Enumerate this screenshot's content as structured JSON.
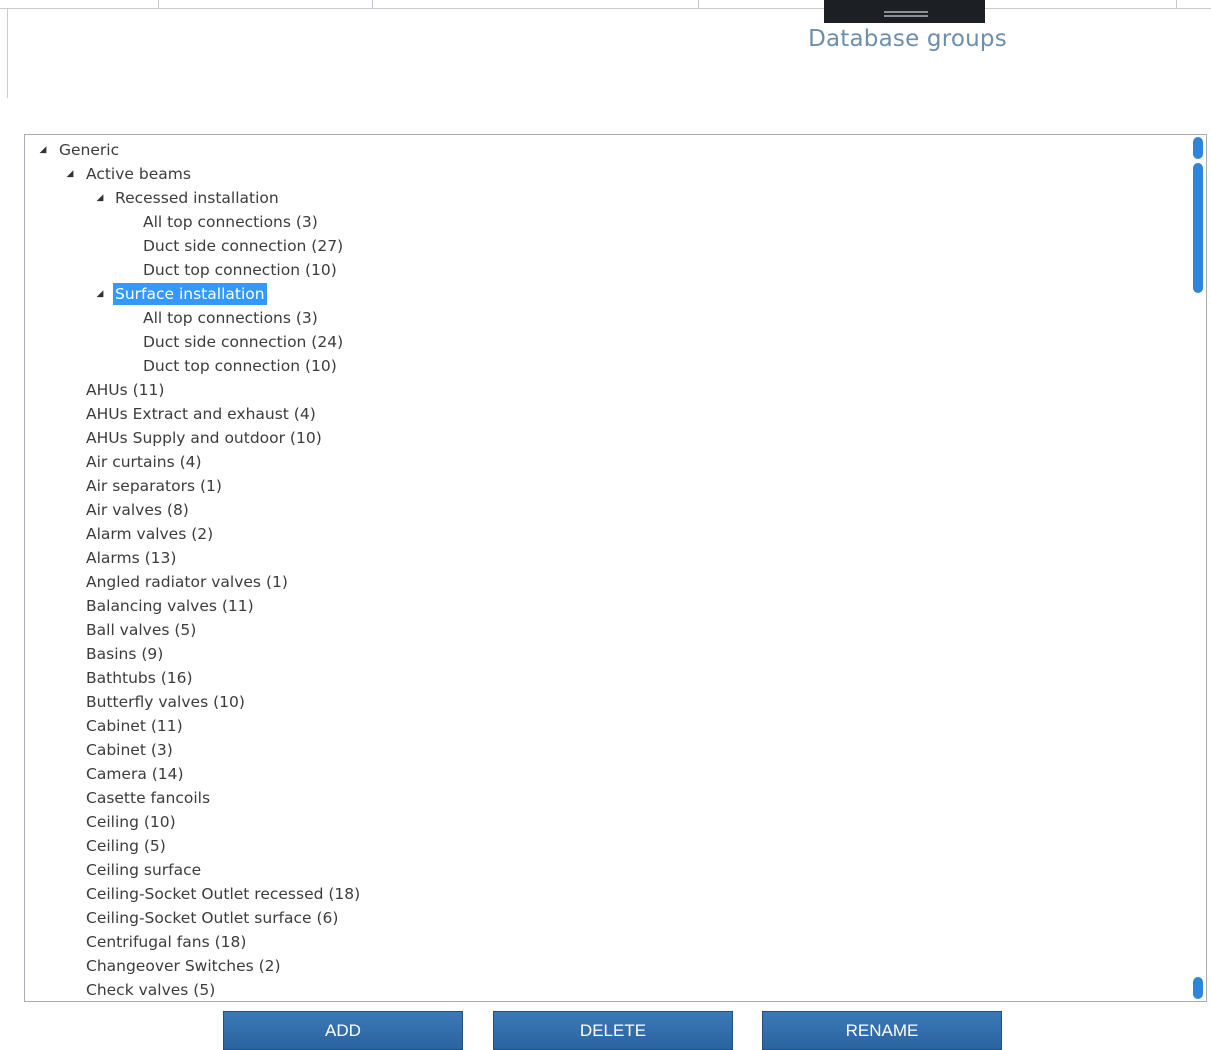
{
  "page": {
    "title": "Database groups"
  },
  "tree": {
    "expanded_arrow": "◢",
    "rows": [
      {
        "label": "Generic",
        "level": "lvl0",
        "expanded": true
      },
      {
        "label": "Active beams",
        "level": "lvl1",
        "expanded": true
      },
      {
        "label": "Recessed installation",
        "level": "lvl2",
        "expanded": true
      },
      {
        "label": "All top connections (3)",
        "level": "lvl3"
      },
      {
        "label": "Duct side connection (27)",
        "level": "lvl3"
      },
      {
        "label": "Duct top connection (10)",
        "level": "lvl3"
      },
      {
        "label": "Surface installation",
        "level": "lvl2",
        "expanded": true,
        "selected": true
      },
      {
        "label": "All top connections (3)",
        "level": "lvl3"
      },
      {
        "label": "Duct side connection (24)",
        "level": "lvl3"
      },
      {
        "label": "Duct top connection (10)",
        "level": "lvl3"
      },
      {
        "label": "AHUs (11)",
        "level": "lvl1leaf"
      },
      {
        "label": "AHUs Extract and exhaust (4)",
        "level": "lvl1leaf"
      },
      {
        "label": "AHUs Supply and outdoor (10)",
        "level": "lvl1leaf"
      },
      {
        "label": "Air curtains (4)",
        "level": "lvl1leaf"
      },
      {
        "label": "Air separators (1)",
        "level": "lvl1leaf"
      },
      {
        "label": "Air valves (8)",
        "level": "lvl1leaf"
      },
      {
        "label": "Alarm valves (2)",
        "level": "lvl1leaf"
      },
      {
        "label": "Alarms (13)",
        "level": "lvl1leaf"
      },
      {
        "label": "Angled radiator valves (1)",
        "level": "lvl1leaf"
      },
      {
        "label": "Balancing valves (11)",
        "level": "lvl1leaf"
      },
      {
        "label": "Ball valves (5)",
        "level": "lvl1leaf"
      },
      {
        "label": "Basins (9)",
        "level": "lvl1leaf"
      },
      {
        "label": "Bathtubs (16)",
        "level": "lvl1leaf"
      },
      {
        "label": "Butterfly valves (10)",
        "level": "lvl1leaf"
      },
      {
        "label": "Cabinet (11)",
        "level": "lvl1leaf"
      },
      {
        "label": "Cabinet (3)",
        "level": "lvl1leaf"
      },
      {
        "label": "Camera (14)",
        "level": "lvl1leaf"
      },
      {
        "label": "Casette fancoils",
        "level": "lvl1leaf"
      },
      {
        "label": "Ceiling (10)",
        "level": "lvl1leaf"
      },
      {
        "label": "Ceiling (5)",
        "level": "lvl1leaf"
      },
      {
        "label": "Ceiling surface",
        "level": "lvl1leaf"
      },
      {
        "label": "Ceiling-Socket Outlet recessed (18)",
        "level": "lvl1leaf"
      },
      {
        "label": "Ceiling-Socket Outlet surface (6)",
        "level": "lvl1leaf"
      },
      {
        "label": "Centrifugal fans (18)",
        "level": "lvl1leaf"
      },
      {
        "label": "Changeover Switches (2)",
        "level": "lvl1leaf"
      },
      {
        "label": "Check valves (5)",
        "level": "lvl1leaf"
      }
    ]
  },
  "buttons": {
    "add": "ADD",
    "delete": "DELETE",
    "rename": "RENAME"
  },
  "colors": {
    "title": "#6d8fae",
    "selection": "#3399ff",
    "button": "#2f6aa8",
    "scrollbar": "#2f86d8"
  },
  "icons": {
    "expand_arrow": "triangle-expanded-icon"
  }
}
